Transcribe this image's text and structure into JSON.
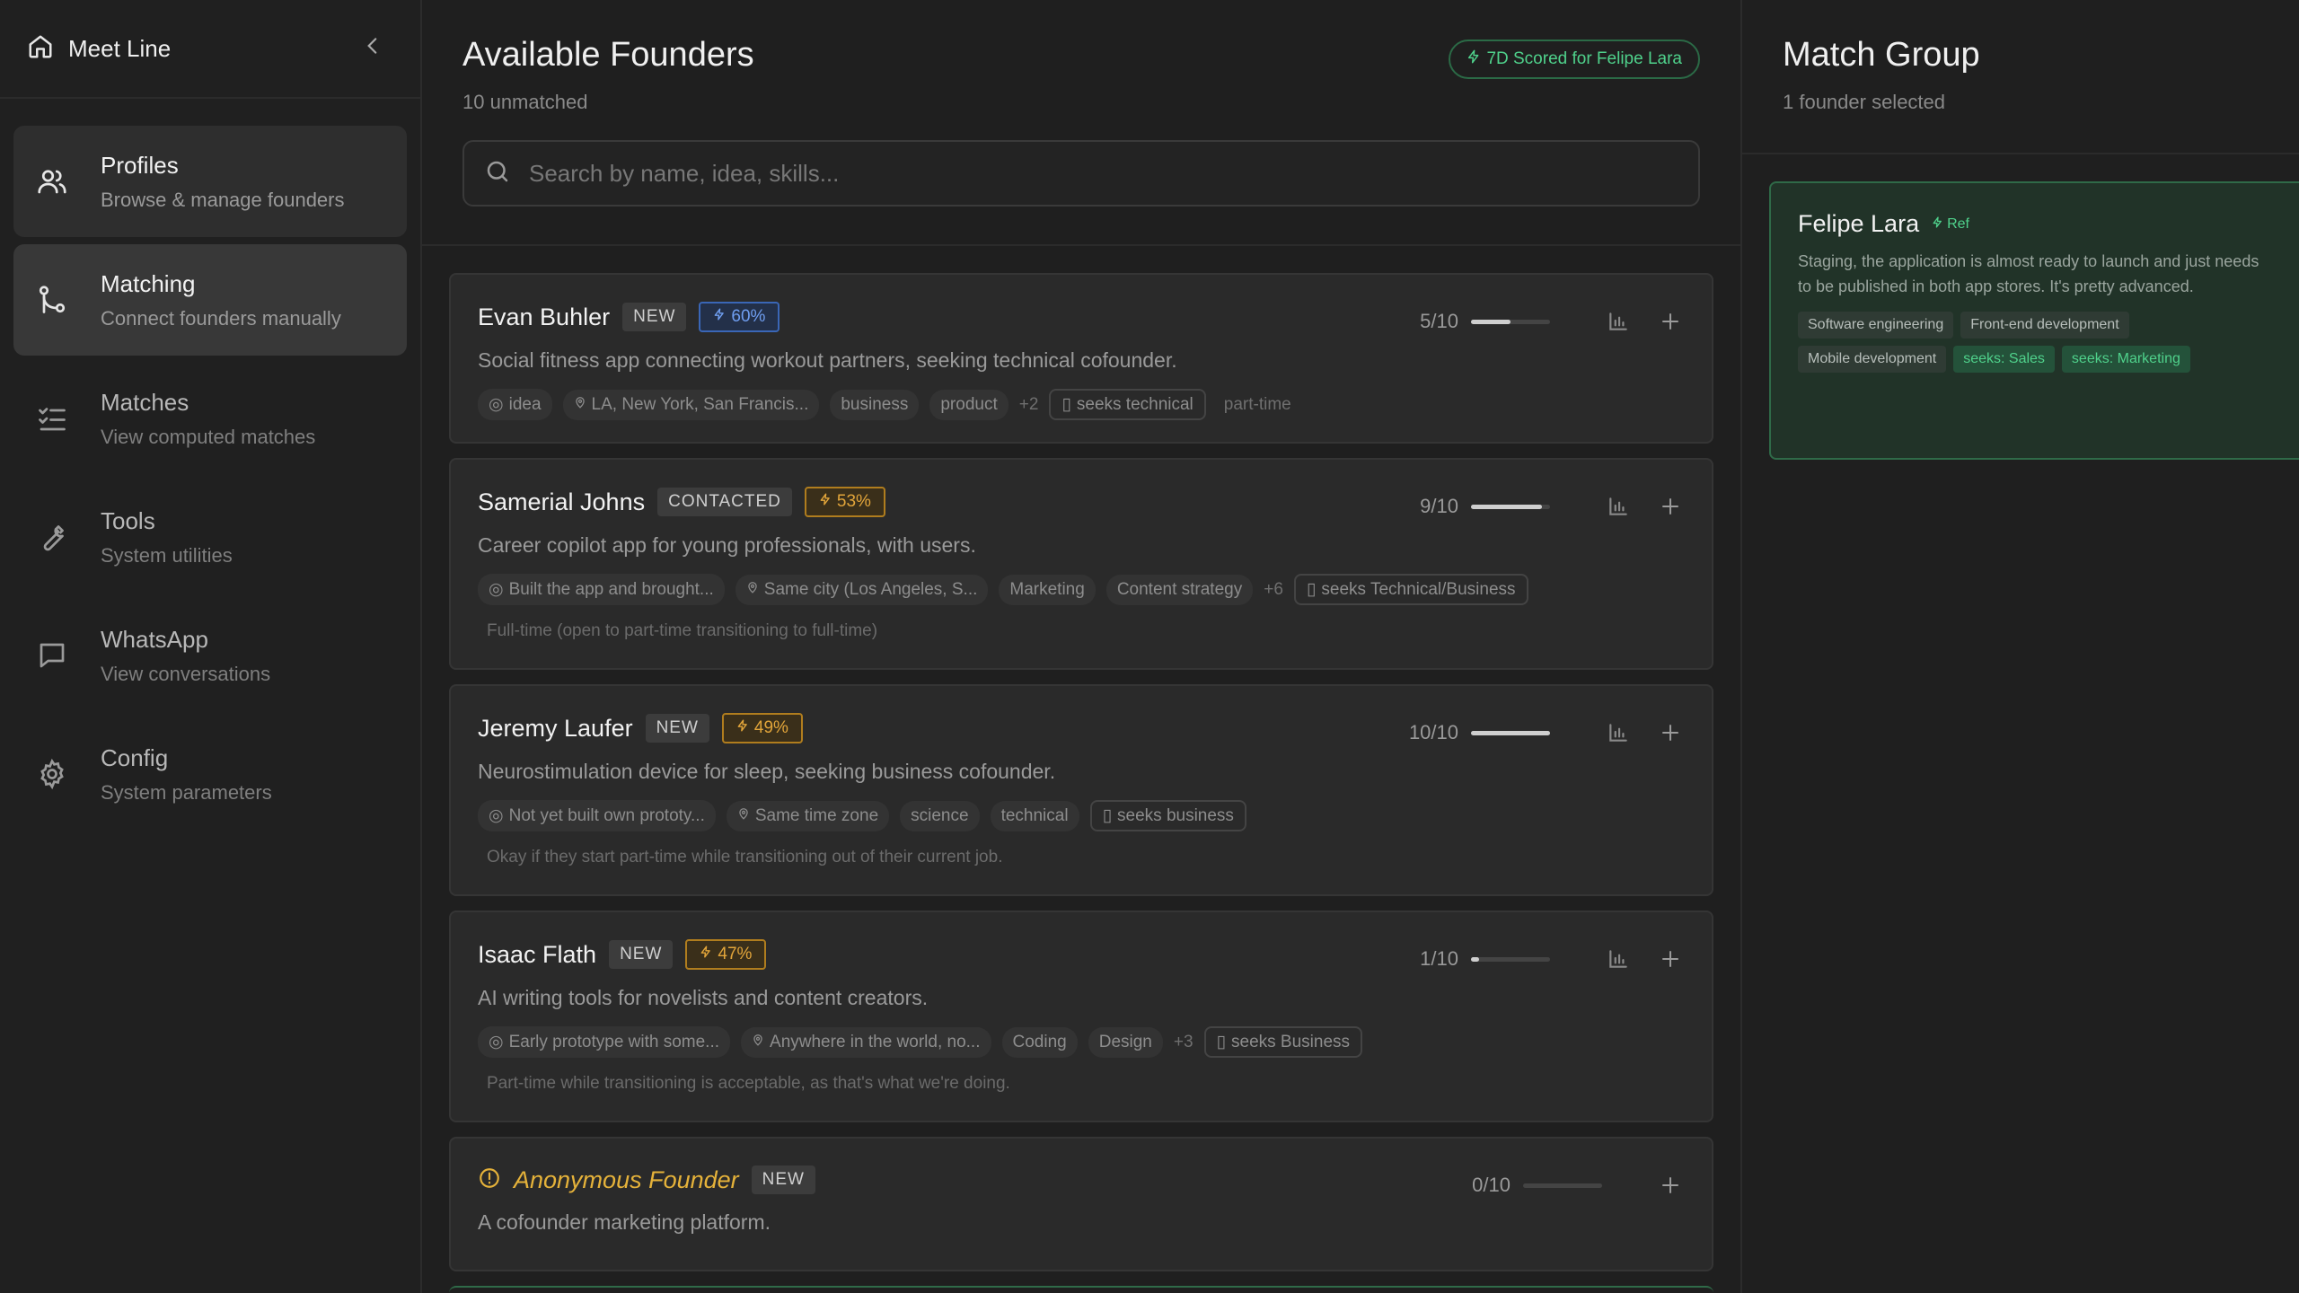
{
  "sidebar": {
    "brand": "Meet Line",
    "items": [
      {
        "title": "Profiles",
        "sub": "Browse & manage founders"
      },
      {
        "title": "Matching",
        "sub": "Connect founders manually"
      },
      {
        "title": "Matches",
        "sub": "View computed matches"
      },
      {
        "title": "Tools",
        "sub": "System utilities"
      },
      {
        "title": "WhatsApp",
        "sub": "View conversations"
      },
      {
        "title": "Config",
        "sub": "System parameters"
      }
    ]
  },
  "main": {
    "title": "Available Founders",
    "subtitle": "10 unmatched",
    "scored_badge": "7D Scored for Felipe Lara",
    "search_placeholder": "Search by name, idea, skills..."
  },
  "founders": [
    {
      "name": "Evan Buhler",
      "status": "NEW",
      "score": "60%",
      "score_color": "#6f9ef0",
      "rating": "5/10",
      "rating_fraction": 0.5,
      "desc": "Social fitness app connecting workout partners, seeking technical cofounder.",
      "stage": "idea",
      "location": "LA, New York, San Francis...",
      "skills": [
        "business",
        "product"
      ],
      "more": "+2",
      "seeks": "seeks technical",
      "commitment": "part-time",
      "note": ""
    },
    {
      "name": "Samerial Johns",
      "status": "CONTACTED",
      "score": "53%",
      "score_color": "#e2a53a",
      "rating": "9/10",
      "rating_fraction": 0.9,
      "desc": "Career copilot app for young professionals, with users.",
      "stage": "Built the app and brought...",
      "location": "Same city (Los Angeles, S...",
      "skills": [
        "Marketing",
        "Content strategy"
      ],
      "more": "+6",
      "seeks": "seeks Technical/Business",
      "note": "Full-time (open to part-time transitioning to full-time)"
    },
    {
      "name": "Jeremy Laufer",
      "status": "NEW",
      "score": "49%",
      "score_color": "#e2a53a",
      "rating": "10/10",
      "rating_fraction": 1.0,
      "desc": "Neurostimulation device for sleep, seeking business cofounder.",
      "stage": "Not yet built own prototy...",
      "location": "Same time zone",
      "skills": [
        "science",
        "technical"
      ],
      "seeks": "seeks business",
      "note": "Okay if they start part-time while transitioning out of their current job."
    },
    {
      "name": "Isaac Flath",
      "status": "NEW",
      "score": "47%",
      "score_color": "#e2a53a",
      "rating": "1/10",
      "rating_fraction": 0.1,
      "desc": "AI writing tools for novelists and content creators.",
      "stage": "Early prototype with some...",
      "location": "Anywhere in the world, no...",
      "skills": [
        "Coding",
        "Design"
      ],
      "more": "+3",
      "seeks": "seeks Business",
      "note": "Part-time while transitioning is acceptable, as that's what we're doing."
    },
    {
      "name": "Anonymous Founder",
      "status": "NEW",
      "rating": "0/10",
      "rating_fraction": 0.0,
      "desc": "A cofounder marketing platform."
    }
  ],
  "match_group": {
    "title": "Match Group",
    "subtitle": "1 founder selected",
    "member": {
      "name": "Felipe Lara",
      "ref": "Ref",
      "desc": "Staging, the application is almost ready to launch and just needs to be published in both app stores. It's pretty advanced.",
      "chips": [
        "Software engineering",
        "Front-end development",
        "Mobile development"
      ],
      "seeks": [
        "seeks: Sales",
        "seeks: Marketing"
      ]
    }
  }
}
